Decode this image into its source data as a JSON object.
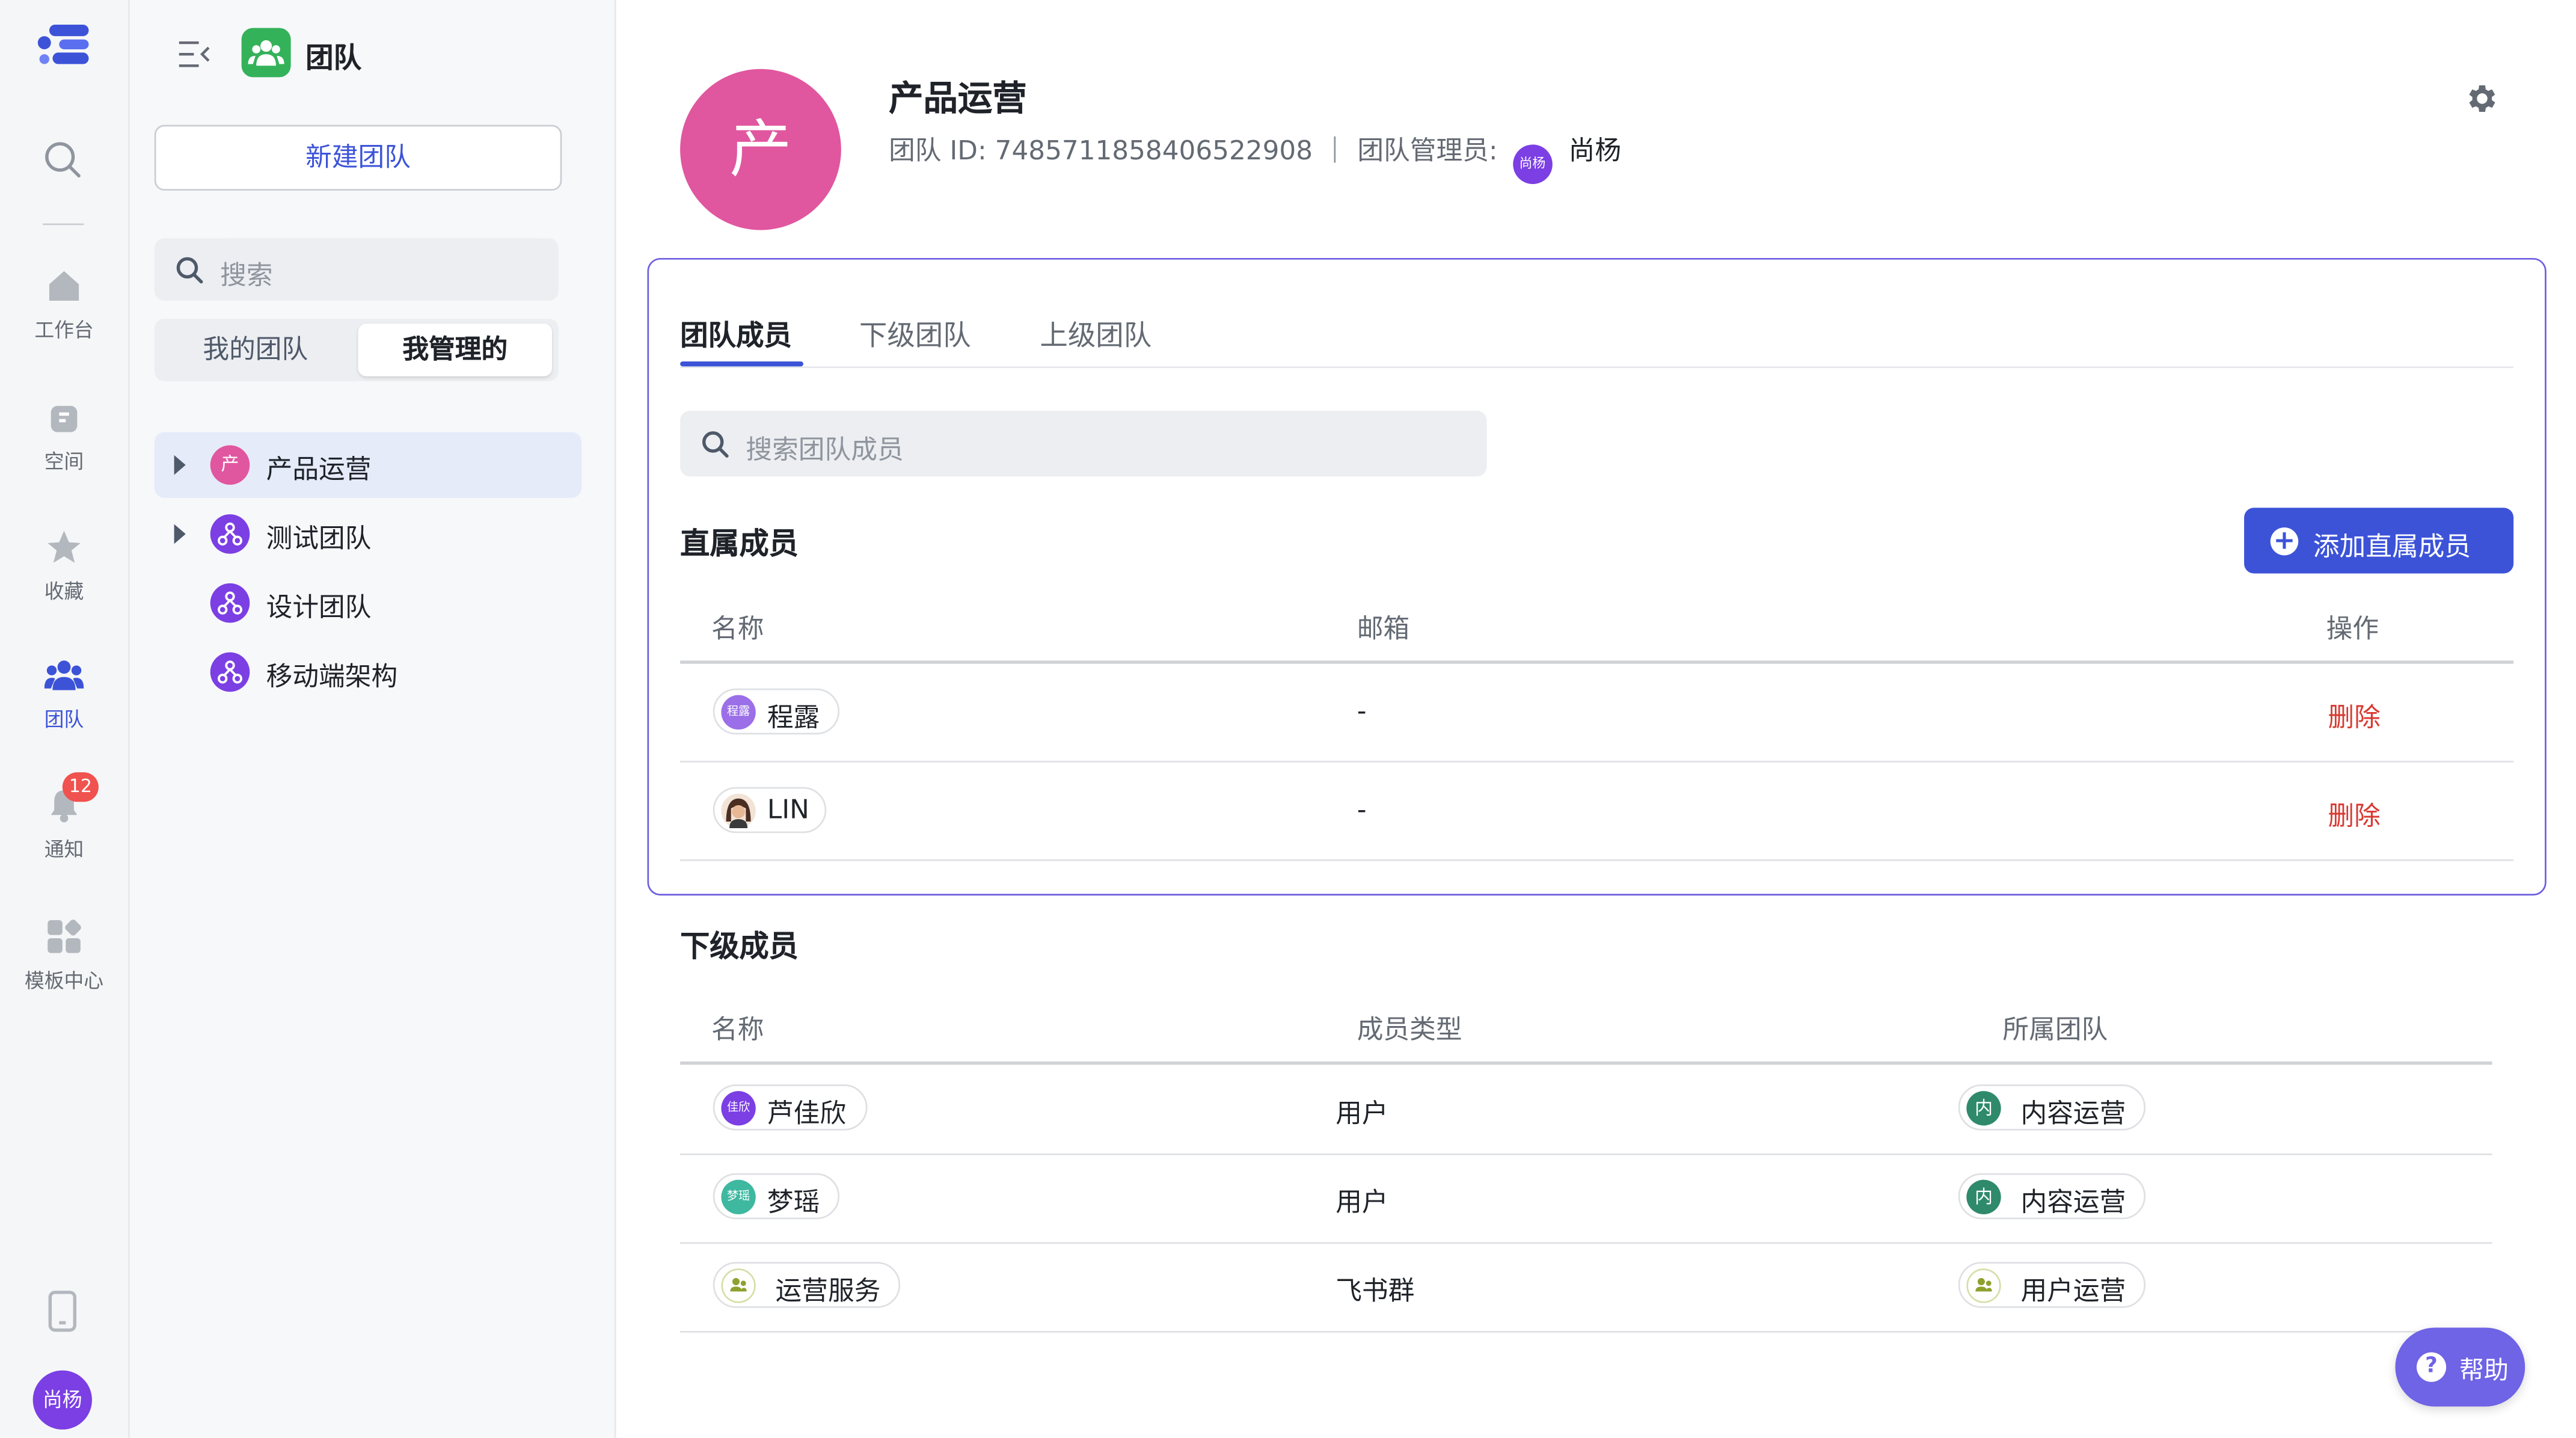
{
  "rail": {
    "items": [
      {
        "label": "工作台"
      },
      {
        "label": "空间"
      },
      {
        "label": "收藏"
      },
      {
        "label": "团队"
      },
      {
        "label": "通知"
      },
      {
        "label": "模板中心"
      }
    ],
    "notification_count": "12",
    "user_avatar": "尚杨"
  },
  "sidebar": {
    "title": "团队",
    "new_team_label": "新建团队",
    "search_placeholder": "搜索",
    "segments": [
      "我的团队",
      "我管理的"
    ],
    "selected_segment": "我管理的",
    "teams": [
      {
        "icon_text": "产",
        "name": "产品运营",
        "expandable": true,
        "selected": true,
        "color": "#e0579f"
      },
      {
        "name": "测试团队",
        "expandable": true,
        "selected": false,
        "color": "#7b3fe4"
      },
      {
        "name": "设计团队",
        "expandable": false,
        "selected": false,
        "color": "#7b3fe4"
      },
      {
        "name": "移动端架构",
        "expandable": false,
        "selected": false,
        "color": "#7b3fe4"
      }
    ]
  },
  "header": {
    "avatar_text": "产",
    "team_name": "产品运营",
    "id_label": "团队 ID:",
    "team_id": "7485711858406522908",
    "admin_label": "团队管理员:",
    "admin_avatar": "尚杨",
    "admin_name": "尚杨"
  },
  "tabs": [
    "团队成员",
    "下级团队",
    "上级团队"
  ],
  "active_tab": "团队成员",
  "member_search_placeholder": "搜索团队成员",
  "direct": {
    "title": "直属成员",
    "add_label": "添加直属成员",
    "columns": [
      "名称",
      "邮箱",
      "操作"
    ],
    "rows": [
      {
        "avatar": "程露",
        "name": "程露",
        "email": "-",
        "action": "删除",
        "avatar_color": "#9b6fe8"
      },
      {
        "avatar": "",
        "name": "LIN",
        "email": "-",
        "action": "删除",
        "avatar_color": "#c98a5c"
      }
    ]
  },
  "sub": {
    "title": "下级成员",
    "columns": [
      "名称",
      "成员类型",
      "所属团队"
    ],
    "rows": [
      {
        "avatar": "佳欣",
        "name": "芦佳欣",
        "type": "用户",
        "team_icon": "内",
        "team": "内容运营",
        "avatar_color": "#7b3fe4",
        "team_color": "#2f8a6b"
      },
      {
        "avatar": "梦瑶",
        "name": "梦瑶",
        "type": "用户",
        "team_icon": "内",
        "team": "内容运营",
        "avatar_color": "#3fb8a0",
        "team_color": "#2f8a6b"
      },
      {
        "avatar": "group-icon",
        "name": "运营服务",
        "type": "飞书群",
        "team_icon": "group-icon",
        "team": "用户运营",
        "avatar_color": "#8fa02e",
        "team_color": "#8fa02e"
      }
    ]
  },
  "help_label": "帮助",
  "colors": {
    "accent": "#3c53d8",
    "danger": "#d83931",
    "card_border": "#6e5fe0"
  }
}
